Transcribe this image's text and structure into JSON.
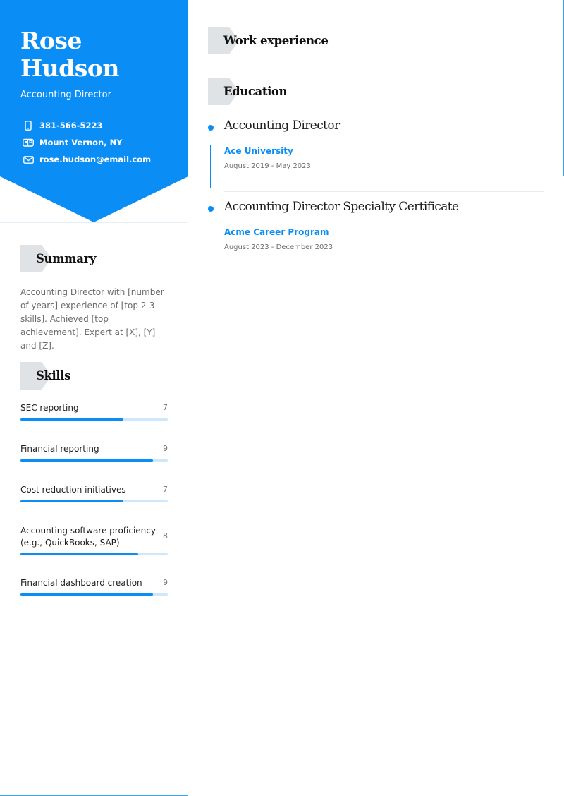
{
  "profile": {
    "name_line1": "Rose",
    "name_line2": "Hudson",
    "title": "Accounting Director"
  },
  "contacts": [
    {
      "icon": "phone-icon",
      "text": "381-566-5223"
    },
    {
      "icon": "mailbox-icon",
      "text": "Mount Vernon, NY"
    },
    {
      "icon": "envelope-icon",
      "text": "rose.hudson@email.com"
    }
  ],
  "sections": {
    "summary": "Summary",
    "skills": "Skills",
    "work": "Work experience",
    "education": "Education"
  },
  "summary_text": "Accounting Director with [number of years] experience of [top 2-3 skills]. Achieved [top achievement]. Expert at [X], [Y] and [Z].",
  "skills": [
    {
      "name": "SEC reporting",
      "level": 7,
      "max": 10
    },
    {
      "name": "Financial reporting",
      "level": 9,
      "max": 10
    },
    {
      "name": "Cost reduction initiatives",
      "level": 7,
      "max": 10
    },
    {
      "name": "Accounting software proficiency (e.g., QuickBooks, SAP)",
      "level": 8,
      "max": 10
    },
    {
      "name": "Financial dashboard creation",
      "level": 9,
      "max": 10
    }
  ],
  "education": [
    {
      "title": "Accounting Director",
      "school": "Ace University",
      "dates": "August 2019 - May 2023"
    },
    {
      "title": "Accounting Director Specialty Certificate",
      "school": "Acme Career Program",
      "dates": "August 2023 - December 2023"
    }
  ],
  "colors": {
    "accent": "#0a8ef5",
    "section_tab": "#dfe3e6",
    "bar_track": "#cfe7fb"
  }
}
